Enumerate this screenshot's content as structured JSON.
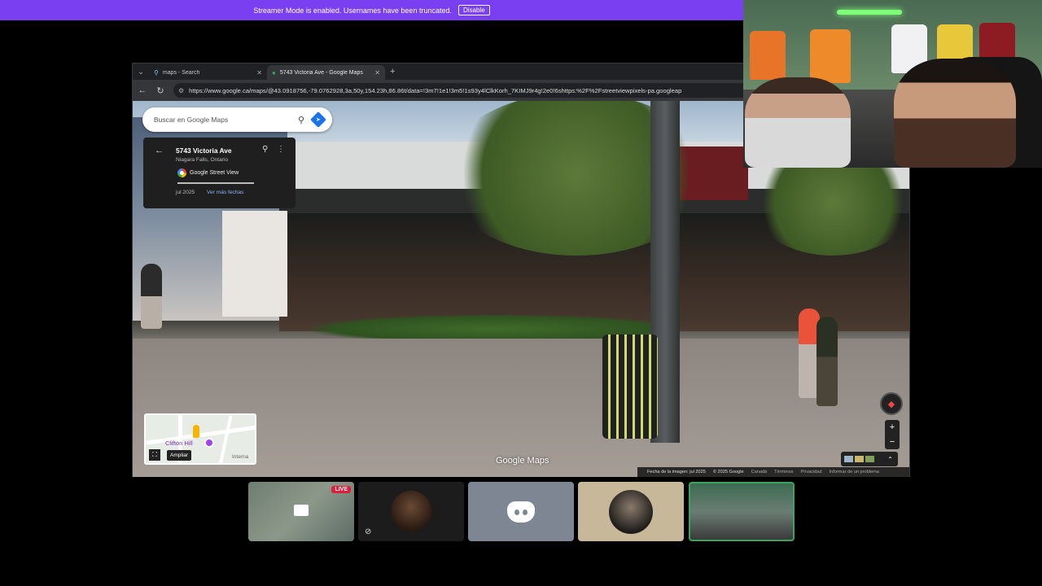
{
  "banner": {
    "message": "Streamer Mode is enabled. Usernames have been truncated.",
    "button": "Disable"
  },
  "browser": {
    "tabs": [
      {
        "title": "maps - Search",
        "active": false
      },
      {
        "title": "5743 Victoria Ave - Google Maps",
        "active": true
      }
    ],
    "url": "https://www.google.ca/maps/@43.0918756,-79.0762928,3a,50y,154.23h,86.86t/data=!3m7!1e1!3m5!1s93y4lClkKorh_7KIMJ9r4g!2e0!6shttps:%2F%2Fstreetviewpixels-pa.googleap"
  },
  "maps": {
    "search_placeholder": "Buscar en Google Maps",
    "place": {
      "address": "5743 Victoria Ave",
      "city": "Niagara Falls, Ontario",
      "source": "Google Street View",
      "date": "jul 2025",
      "more_dates": "Ver más fechas"
    },
    "minimap": {
      "label": "Clifton Hill",
      "label2": "Interna",
      "expand_tooltip": "Ampliar"
    },
    "logo": "Google Maps",
    "zoom_in": "+",
    "zoom_out": "−",
    "footer": {
      "image_date": "Fecha de la imagen: jul 2025",
      "copyright": "© 2025 Google",
      "country": "Canadá",
      "terms": "Términos",
      "privacy": "Privacidad",
      "report": "Informar de un problema"
    }
  },
  "call": {
    "live_badge": "LIVE"
  },
  "colors": {
    "banner": "#7b3ff2",
    "live": "#e01e3c",
    "speaking_border": "#3ba55d"
  }
}
